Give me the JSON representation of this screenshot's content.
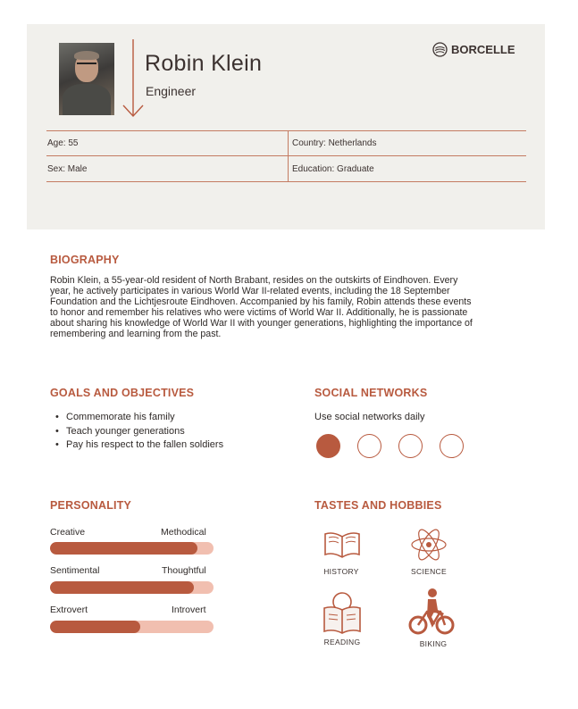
{
  "profile": {
    "name": "Robin Klein",
    "role": "Engineer",
    "brand": "BORCELLE",
    "age": "Age: 55",
    "country": "Country: Netherlands",
    "sex": "Sex: Male",
    "education": "Education: Graduate"
  },
  "biography": {
    "heading": "BIOGRAPHY",
    "text": "Robin Klein, a 55-year-old resident of North Brabant, resides on the outskirts of Eindhoven. Every year, he actively participates in various World War II-related events, including the 18 September Foundation and the Lichtjesroute Eindhoven. Accompanied by his family, Robin attends these events to honor and remember his relatives who were victims of World War II. Additionally, he is passionate about sharing his knowledge of World War II with younger generations, highlighting the importance of remembering and learning from the past."
  },
  "goals": {
    "heading": "GOALS AND OBJECTIVES",
    "items": [
      "Commemorate his family",
      "Teach younger generations",
      "Pay his respect to the fallen soldiers"
    ]
  },
  "social": {
    "heading": "SOCIAL NETWORKS",
    "text": "Use social networks daily",
    "level": 1,
    "max": 4
  },
  "personality": {
    "heading": "PERSONALITY",
    "traits": [
      {
        "left": "Creative",
        "right": "Methodical",
        "value": 0.9
      },
      {
        "left": "Sentimental",
        "right": "Thoughtful",
        "value": 0.88
      },
      {
        "left": "Extrovert",
        "right": "Introvert",
        "value": 0.55
      }
    ]
  },
  "hobbies": {
    "heading": "TASTES AND HOBBIES",
    "items": [
      {
        "label": "HISTORY",
        "icon": "open-book-icon"
      },
      {
        "label": "SCIENCE",
        "icon": "atom-icon"
      },
      {
        "label": "READING",
        "icon": "reading-person-icon"
      },
      {
        "label": "BIKING",
        "icon": "cyclist-icon"
      }
    ]
  },
  "colors": {
    "accent": "#b85a3f",
    "bar_track": "#f1bfb0",
    "header_bg": "#f1f0ec"
  }
}
